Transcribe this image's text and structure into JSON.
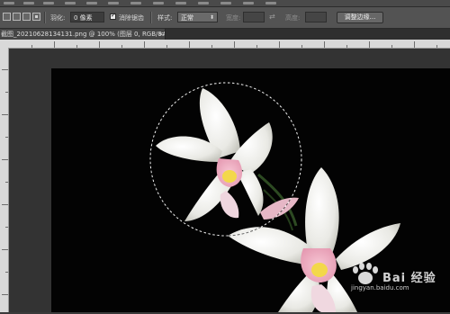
{
  "options_bar": {
    "feather_label": "羽化:",
    "feather_value": "0 像素",
    "antialias_label": "消除锯齿",
    "style_label": "样式:",
    "style_value": "正常",
    "width_label": "宽度:",
    "height_label": "高度:",
    "refine_edge_button": "调整边缘..."
  },
  "document_tab": {
    "title": "截图_20210628134131.png @ 100% (图层 0, RGB/8#) *",
    "close": "×"
  },
  "watermark": {
    "brand": "Bai 经验",
    "url": "jingyan.baidu.com"
  }
}
